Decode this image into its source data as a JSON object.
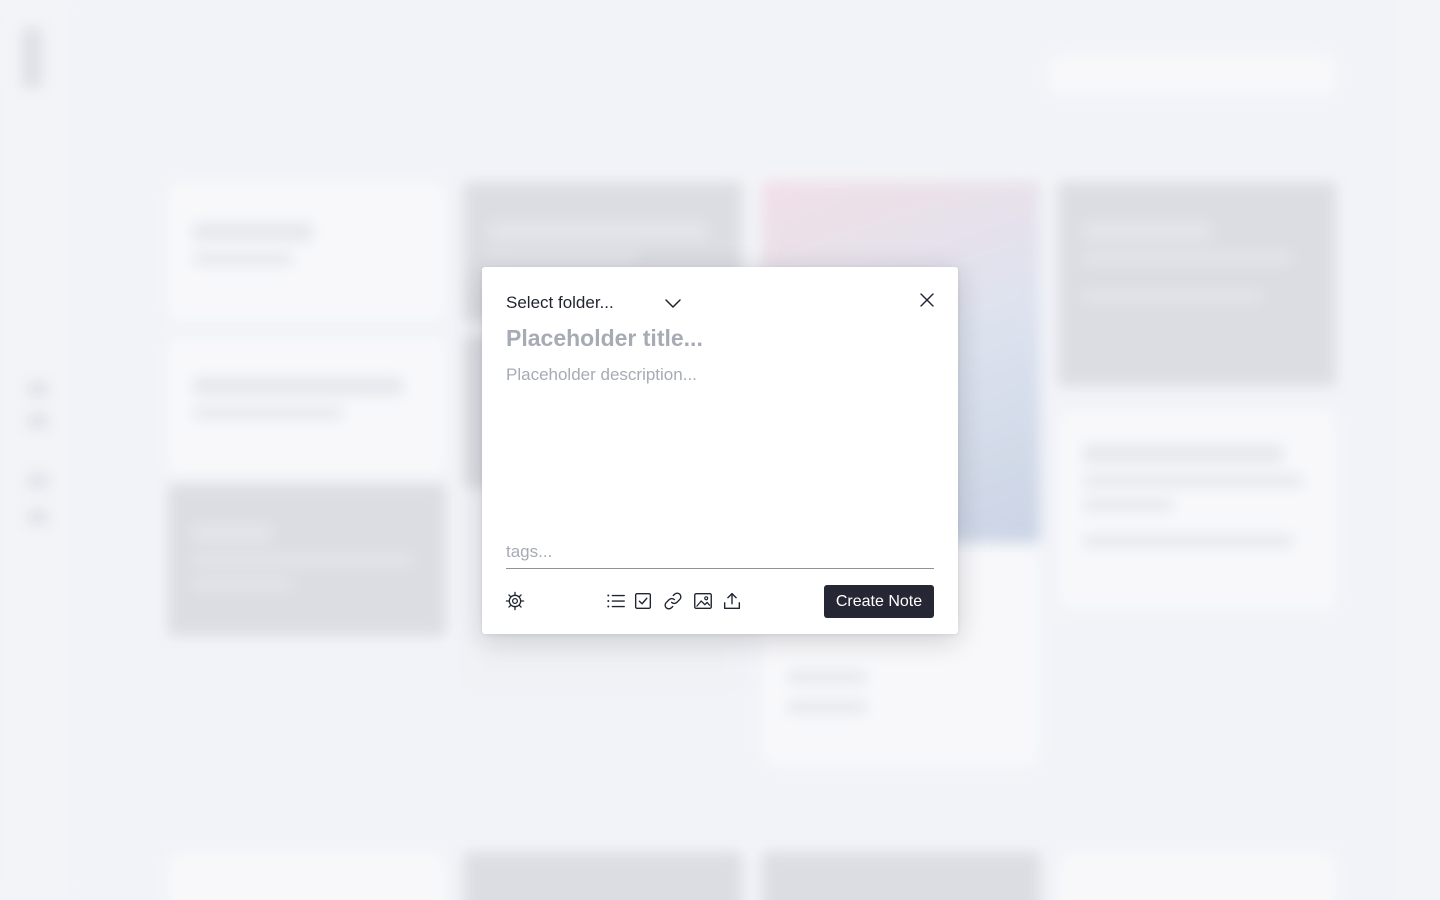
{
  "modal": {
    "folder_select_label": "Select folder...",
    "title_placeholder": "Placeholder title...",
    "description_placeholder": "Placeholder description...",
    "tags_placeholder": "tags...",
    "create_button_label": "Create Note"
  },
  "icons": {
    "folder_dropdown": "chevron-down-icon",
    "close": "close-icon",
    "settings": "gear-icon",
    "bullet_list": "bullet-list-icon",
    "checkbox": "checkbox-icon",
    "link": "link-icon",
    "image": "image-icon",
    "upload": "upload-icon"
  },
  "colors": {
    "primary_button": "#252834",
    "placeholder_text": "#a6abb4",
    "text": "#1f2430",
    "backdrop": "#f2f4f8"
  }
}
